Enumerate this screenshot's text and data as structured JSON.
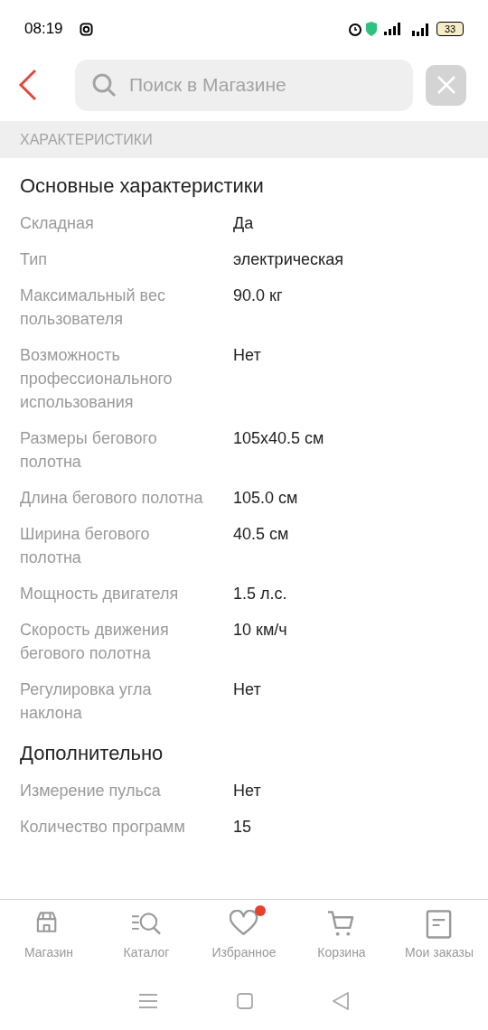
{
  "status_bar": {
    "time": "08:19",
    "battery": "33"
  },
  "search": {
    "placeholder": "Поиск в Магазине"
  },
  "section_title": "ХАРАКТЕРИСТИКИ",
  "groups": [
    {
      "title": "Основные характеристики",
      "rows": [
        {
          "label": "Складная",
          "value": "Да"
        },
        {
          "label": "Тип",
          "value": "электрическая"
        },
        {
          "label": "Максимальный вес пользователя",
          "value": "90.0 кг"
        },
        {
          "label": "Возможность профессионального использования",
          "value": "Нет"
        },
        {
          "label": "Размеры бегового полотна",
          "value": "105x40.5 см"
        },
        {
          "label": "Длина бегового полотна",
          "value": "105.0 см"
        },
        {
          "label": "Ширина бегового полотна",
          "value": "40.5 см"
        },
        {
          "label": "Мощность двигателя",
          "value": "1.5 л.с."
        },
        {
          "label": "Скорость движения бегового полотна",
          "value": "10 км/ч"
        },
        {
          "label": "Регулировка угла наклона",
          "value": "Нет"
        }
      ]
    },
    {
      "title": "Дополнительно",
      "rows": [
        {
          "label": "Измерение пульса",
          "value": "Нет"
        },
        {
          "label": "Количество программ",
          "value": "15"
        }
      ]
    }
  ],
  "bottom_nav": [
    {
      "kind": "store",
      "label": "Магазин",
      "badge": false
    },
    {
      "kind": "catalog",
      "label": "Каталог",
      "badge": false
    },
    {
      "kind": "favorites",
      "label": "Избранное",
      "badge": true
    },
    {
      "kind": "cart",
      "label": "Корзина",
      "badge": false
    },
    {
      "kind": "orders",
      "label": "Мои заказы",
      "badge": false
    }
  ]
}
